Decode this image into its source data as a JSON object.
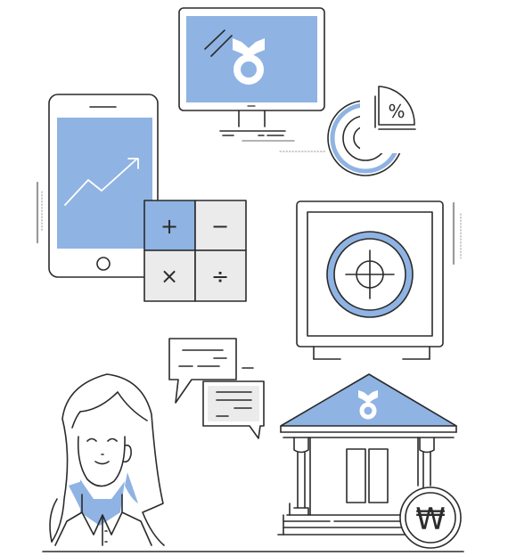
{
  "colors": {
    "accent": "#8fb3e3",
    "line": "#2b2b2b",
    "key_fill": "#ebebeb",
    "grey": "#9a9a9a"
  },
  "chart_icon": {
    "symbol": "%"
  },
  "calculator": {
    "keys": [
      "+",
      "−",
      "×",
      "÷"
    ]
  },
  "currency": {
    "symbol": "₩"
  },
  "icons": {
    "monitor": "monitor-icon",
    "logo": "ribbon-ring-logo-icon",
    "pie": "pie-chart-icon",
    "phone": "smartphone-icon",
    "trend": "trend-up-icon",
    "calculator": "calculator-icon",
    "safe": "safe-icon",
    "chat": "chat-bubbles-icon",
    "person": "woman-avatar-icon",
    "bank": "bank-building-icon",
    "coin": "won-coin-icon"
  }
}
